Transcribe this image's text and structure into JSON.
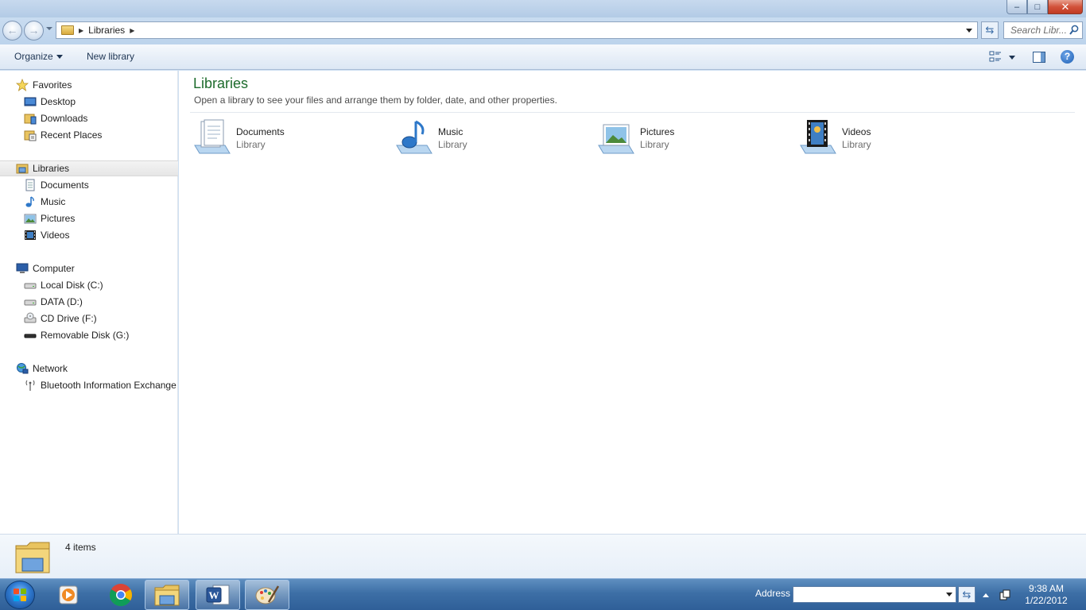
{
  "window": {
    "controls": {
      "minimize": "–",
      "maximize": "□",
      "close": "✕"
    }
  },
  "navigation": {
    "back_glyph": "←",
    "forward_glyph": "→",
    "breadcrumb": [
      "Libraries"
    ],
    "refresh_glyph": "⇆",
    "search_placeholder": "Search Libr..."
  },
  "toolbar": {
    "organize_label": "Organize",
    "new_library_label": "New library",
    "help_glyph": "?"
  },
  "sidebar": {
    "favorites": {
      "label": "Favorites",
      "icon": "star-icon",
      "items": [
        {
          "label": "Desktop",
          "icon": "desktop-icon"
        },
        {
          "label": "Downloads",
          "icon": "downloads-folder-icon"
        },
        {
          "label": "Recent Places",
          "icon": "recent-places-icon"
        }
      ]
    },
    "libraries": {
      "label": "Libraries",
      "icon": "libraries-icon",
      "items": [
        {
          "label": "Documents",
          "icon": "documents-icon"
        },
        {
          "label": "Music",
          "icon": "music-icon"
        },
        {
          "label": "Pictures",
          "icon": "pictures-icon"
        },
        {
          "label": "Videos",
          "icon": "videos-icon"
        }
      ]
    },
    "computer": {
      "label": "Computer",
      "icon": "computer-icon",
      "items": [
        {
          "label": "Local Disk (C:)",
          "icon": "hard-disk-icon"
        },
        {
          "label": "DATA (D:)",
          "icon": "hard-disk-icon"
        },
        {
          "label": "CD Drive (F:)",
          "icon": "cd-drive-icon"
        },
        {
          "label": "Removable Disk (G:)",
          "icon": "removable-disk-icon"
        }
      ]
    },
    "network": {
      "label": "Network",
      "icon": "network-icon",
      "items": [
        {
          "label": "Bluetooth Information Exchange",
          "icon": "bluetooth-icon"
        }
      ]
    }
  },
  "main": {
    "title": "Libraries",
    "description": "Open a library to see your files and arrange them by folder, date, and other properties.",
    "libraries": [
      {
        "name": "Documents",
        "type": "Library",
        "icon": "documents-library-icon"
      },
      {
        "name": "Music",
        "type": "Library",
        "icon": "music-library-icon"
      },
      {
        "name": "Pictures",
        "type": "Library",
        "icon": "pictures-library-icon"
      },
      {
        "name": "Videos",
        "type": "Library",
        "icon": "videos-library-icon"
      }
    ]
  },
  "details": {
    "item_count": "4 items"
  },
  "taskbar": {
    "apps": [
      {
        "name": "media-player-icon"
      },
      {
        "name": "chrome-icon"
      },
      {
        "name": "explorer-icon"
      },
      {
        "name": "word-icon"
      },
      {
        "name": "paint-icon"
      }
    ],
    "address_label": "Address",
    "address_value": "",
    "refresh_glyph": "⇆",
    "time": "9:38 AM",
    "date": "1/22/2012"
  },
  "colors": {
    "title_green": "#1d6b2c",
    "chrome_blue": "#c9dcf0",
    "taskbar_blue": "#3d6fa6"
  }
}
